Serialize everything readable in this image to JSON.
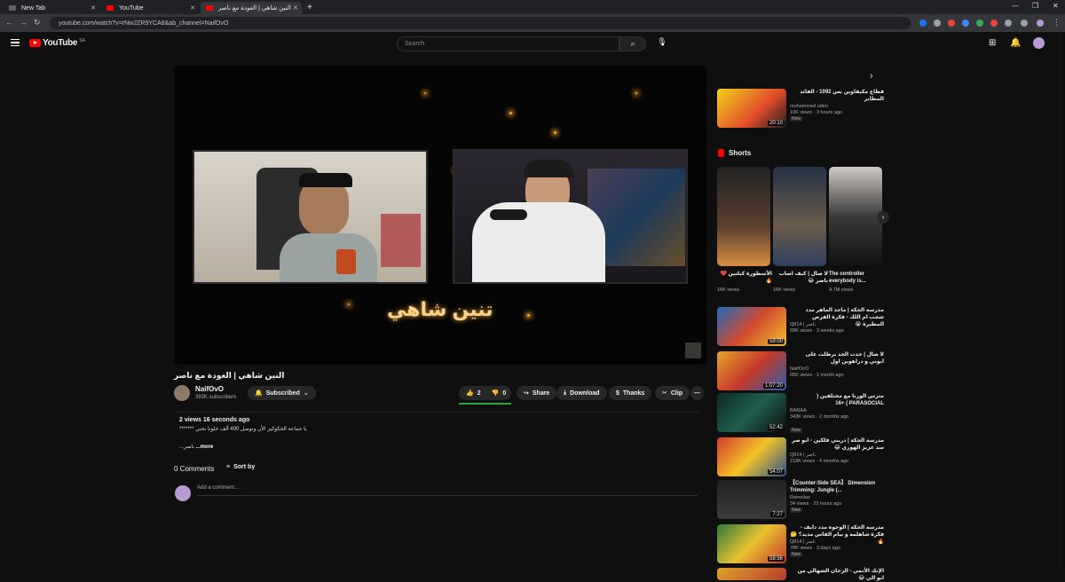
{
  "browser": {
    "tabs": [
      {
        "label": "New Tab",
        "active": false
      },
      {
        "label": "YouTube",
        "active": false
      },
      {
        "label": "النين شاهي | العودة مع ناصر",
        "active": true
      }
    ],
    "url": "youtube.com/watch?v=rNw2ZR9YCA8&ab_channel=NaifOvO"
  },
  "header": {
    "logo": "YouTube",
    "country": "SA",
    "search_placeholder": "Search"
  },
  "video": {
    "title": "النين شاهي | العودة مع ناصر",
    "overlay_text": "تنين شاهي",
    "channel": "NaifOvO",
    "subscribers": "393K subscribers",
    "subscribe_label": "Subscribed",
    "likes": "2",
    "dislikes": "0",
    "share": "Share",
    "download": "Download",
    "thanks": "Thanks",
    "clip": "Clip",
    "more": "⋯"
  },
  "description": {
    "meta": "2 views  16 seconds ago",
    "text": "يا جماعة الخكوكيز الأن ونوصل 400 ألف خلونا نحني *******",
    "more_prefix": "...ناصر",
    "more_label": "...more"
  },
  "comments": {
    "count_label": "0 Comments",
    "sort_label": "Sort by",
    "placeholder": "Add a comment..."
  },
  "sidebar": {
    "top": {
      "title": "قطاع مكيفاوين بس 1092 - الفائد المطاير",
      "channel": "mohammed oden",
      "views": "10K views · 3 hours ago",
      "badge": "New",
      "duration": "20:10"
    },
    "shorts_label": "Shorts",
    "shorts": [
      {
        "title": "الأسطورة كبلتين ❤️ 🔥",
        "views": "16K views"
      },
      {
        "title": "لا صال | كيف اصاب ناصر 😂",
        "views": "16K views"
      },
      {
        "title": "The controller everybody is...",
        "views": "4.7M views"
      }
    ],
    "videos": [
      {
        "title": "مدرسة الحكة | ماجد الماهر مدد شجب ام اللك - فكرة الفرص المطيرة 😭",
        "channel": "Q814 | ناصر",
        "views": "69K views · 3 weeks ago",
        "duration": "59:00"
      },
      {
        "title": "لا صال | جدت الجد برطلت على ابوني و دراهوين اول",
        "channel": "NaifOvO",
        "views": "65K views · 1 month ago",
        "duration": "1:07:20"
      },
      {
        "title": "مترس الورنا مع مختلفين ( PARASOCIAL ) +16",
        "channel": "BARAA",
        "views": "343K views · 2 months ago",
        "duration": "52:42",
        "badge": "New"
      },
      {
        "title": "مدرسة الحكة | دريني فلكين - ابو صر سد عزيز الهوري 😂",
        "channel": "Q814 | ناصر",
        "views": "218K views · 4 months ago",
        "duration": "54:07"
      },
      {
        "title": "【Counter:Side SEA】 Dimension Trimming: Jungle (...",
        "channel": "Reinellas",
        "views": "34 views · 23 hours ago",
        "duration": "7:27",
        "badge": "New"
      },
      {
        "title": "مدرسة الحكة | الوجوه مدد دايف - فكرة شاهلمة و بيام الفاس مديد؟ 🤔 🔥",
        "channel": "Q814 | ناصر",
        "views": "78K views · 3 days ago",
        "duration": "58:56",
        "badge": "New"
      },
      {
        "title": "الإنك الأنمي - الزحان الشهالي من ابو الي 😂",
        "channel": "",
        "views": "",
        "duration": ""
      }
    ]
  },
  "colors": {
    "bg": "#0f0f0f",
    "accent": "#ff0000",
    "like_bar": "#2ba640"
  }
}
